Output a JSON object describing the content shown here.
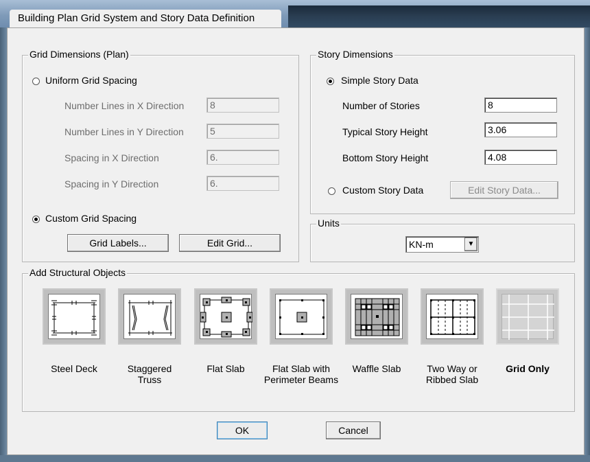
{
  "window": {
    "title": "Building Plan Grid System and Story Data Definition"
  },
  "grid": {
    "legend": "Grid Dimensions (Plan)",
    "uniform_label": "Uniform Grid Spacing",
    "uniform_selected": false,
    "fields": [
      {
        "label": "Number Lines in X Direction",
        "value": "8"
      },
      {
        "label": "Number Lines in Y Direction",
        "value": "5"
      },
      {
        "label": "Spacing in X Direction",
        "value": "6."
      },
      {
        "label": "Spacing in Y Direction",
        "value": "6."
      }
    ],
    "custom_label": "Custom Grid Spacing",
    "custom_selected": true,
    "grid_labels_button": "Grid Labels...",
    "edit_grid_button": "Edit Grid..."
  },
  "story": {
    "legend": "Story Dimensions",
    "simple_label": "Simple Story Data",
    "simple_selected": true,
    "fields": [
      {
        "label": "Number of Stories",
        "value": "8"
      },
      {
        "label": "Typical Story Height",
        "value": "3.06"
      },
      {
        "label": "Bottom Story Height",
        "value": "4.08"
      }
    ],
    "custom_label": "Custom Story Data",
    "custom_selected": false,
    "edit_story_button": "Edit Story Data..."
  },
  "units": {
    "legend": "Units",
    "selected": "KN-m"
  },
  "objects": {
    "legend": "Add Structural Objects",
    "items": [
      {
        "label1": "Steel Deck",
        "label2": "",
        "icon": "steel-deck-icon"
      },
      {
        "label1": "Staggered",
        "label2": "Truss",
        "icon": "staggered-truss-icon"
      },
      {
        "label1": "Flat Slab",
        "label2": "",
        "icon": "flat-slab-icon"
      },
      {
        "label1": "Flat Slab with",
        "label2": "Perimeter Beams",
        "icon": "flat-slab-perimeter-beams-icon"
      },
      {
        "label1": "Waffle Slab",
        "label2": "",
        "icon": "waffle-slab-icon"
      },
      {
        "label1": "Two Way or",
        "label2": "Ribbed Slab",
        "icon": "two-way-ribbed-slab-icon"
      },
      {
        "label1": "Grid Only",
        "label2": "",
        "icon": "grid-only-icon"
      }
    ]
  },
  "buttons": {
    "ok": "OK",
    "cancel": "Cancel"
  }
}
